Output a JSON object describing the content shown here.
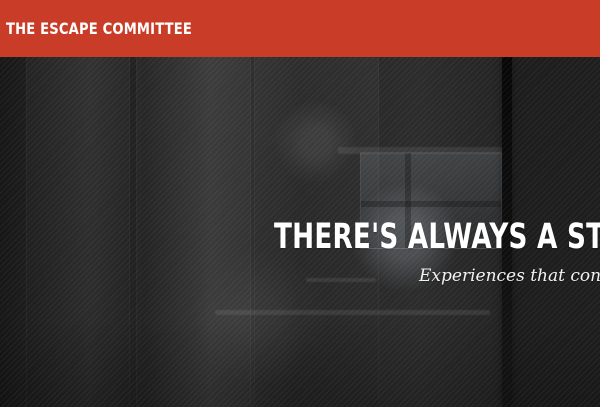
{
  "header": {
    "logo_text": "THE ESCAPE COMMITTEE"
  },
  "hero": {
    "headline": "THERE'S ALWAYS A STOR",
    "subtitle": "Experiences that conne"
  },
  "colors": {
    "header_background": "#c93d28",
    "text_primary": "#ffffff",
    "hero_dark": "#1f1f1f"
  }
}
